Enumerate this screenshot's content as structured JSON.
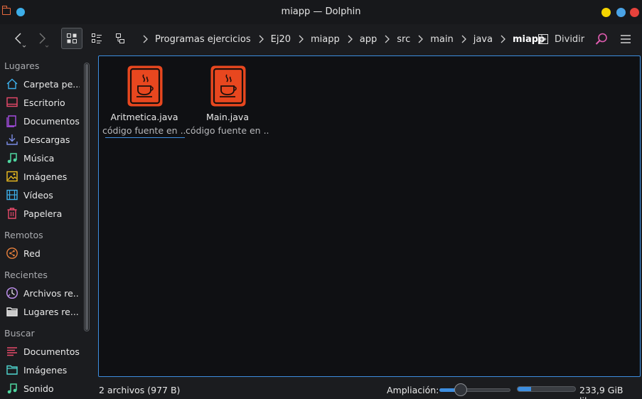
{
  "window": {
    "title": "miapp — Dolphin",
    "controls": {
      "minimize_color": "#f5d400",
      "maximize_color": "#4aa3e6",
      "close_color": "#e6423c"
    }
  },
  "toolbar": {
    "back_icon": "chevron-left-icon",
    "forward_icon": "chevron-right-icon",
    "view_modes": [
      "icons-view-icon",
      "compact-view-icon",
      "details-view-icon"
    ],
    "active_view": "icons",
    "breadcrumb": [
      "Programas ejercicios",
      "Ej20",
      "miapp",
      "app",
      "src",
      "main",
      "java",
      "miapp"
    ],
    "split_label": "Dividir",
    "search_icon": "search-icon",
    "menu_icon": "hamburger-menu-icon"
  },
  "sidebar": {
    "sections": [
      {
        "title": "Lugares",
        "items": [
          {
            "label": "Carpeta pe...",
            "icon": "home-icon",
            "color": "#3daee9"
          },
          {
            "label": "Escritorio",
            "icon": "desktop-icon",
            "color": "#e84a6a"
          },
          {
            "label": "Documentos",
            "icon": "documents-icon",
            "color": "#a44de0"
          },
          {
            "label": "Descargas",
            "icon": "download-icon",
            "color": "#7a8ce6"
          },
          {
            "label": "Música",
            "icon": "music-icon",
            "color": "#4fd6a0"
          },
          {
            "label": "Imágenes",
            "icon": "pictures-icon",
            "color": "#f0c020"
          },
          {
            "label": "Vídeos",
            "icon": "videos-icon",
            "color": "#3daee9"
          },
          {
            "label": "Papelera",
            "icon": "trash-icon",
            "color": "#e84a6a"
          }
        ]
      },
      {
        "title": "Remotos",
        "items": [
          {
            "label": "Red",
            "icon": "network-icon",
            "color": "#e8803c"
          }
        ]
      },
      {
        "title": "Recientes",
        "items": [
          {
            "label": "Archivos re...",
            "icon": "recent-files-icon",
            "color": "#b88ce6"
          },
          {
            "label": "Lugares re...",
            "icon": "recent-places-icon",
            "color": "#e8e8e8"
          }
        ]
      },
      {
        "title": "Buscar",
        "items": [
          {
            "label": "Documentos",
            "icon": "search-documents-icon",
            "color": "#e84a6a"
          },
          {
            "label": "Imágenes",
            "icon": "search-pictures-icon",
            "color": "#4fd6d0"
          },
          {
            "label": "Sonido",
            "icon": "search-audio-icon",
            "color": "#4fd6a0"
          }
        ]
      }
    ]
  },
  "files": [
    {
      "name": "Aritmetica.java",
      "type": "código fuente en ...",
      "icon": "java-file-icon",
      "focused": true
    },
    {
      "name": "Main.java",
      "type": "código fuente en ...",
      "icon": "java-file-icon",
      "focused": false
    }
  ],
  "statusbar": {
    "summary": "2 archivos (977 B)",
    "zoom_label": "Ampliación:",
    "zoom_level": 0.3,
    "free_space": "233,9 GiB libre",
    "disk_used_fraction": 0.24
  },
  "colors": {
    "accent": "#3d8ee0",
    "java_icon": "#e8471f"
  }
}
